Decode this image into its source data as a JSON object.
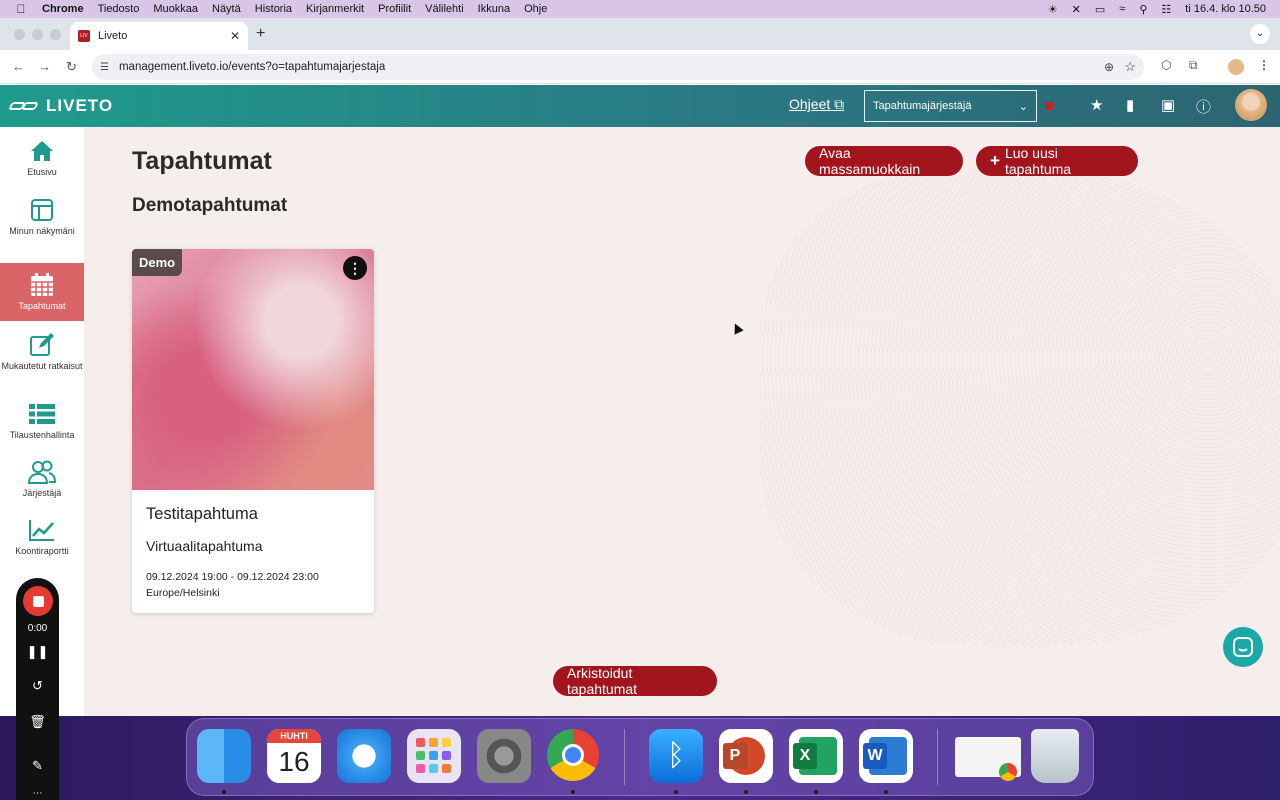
{
  "menubar": {
    "items": [
      "Chrome",
      "Tiedosto",
      "Muokkaa",
      "Näytä",
      "Historia",
      "Kirjanmerkit",
      "Profiilit",
      "Välilehti",
      "Ikkuna",
      "Ohje"
    ],
    "clock": "ti 16.4. klo 10.50"
  },
  "browser": {
    "tab_title": "Liveto",
    "url": "management.liveto.io/events?o=tapahtumajarjestaja"
  },
  "header": {
    "logo_text": "LIVETO",
    "help_link": "Ohjeet",
    "org_select": "Tapahtumajärjestäjä"
  },
  "sidebar": {
    "items": [
      {
        "label": "Etusivu",
        "icon": "home-icon"
      },
      {
        "label": "Minun näkymäni",
        "icon": "layout-icon"
      },
      {
        "label": "Tapahtumat",
        "icon": "calendar-icon",
        "active": true
      },
      {
        "label": "Mukautetut ratkaisut",
        "icon": "edit-icon"
      },
      {
        "label": "Tilaustenhallinta",
        "icon": "list-icon"
      },
      {
        "label": "Järjestäjä",
        "icon": "users-icon"
      },
      {
        "label": "Koontiraportti",
        "icon": "chart-icon"
      }
    ]
  },
  "main": {
    "title": "Tapahtumat",
    "bulk_edit_button": "Avaa massamuokkain",
    "create_button": "Luo uusi tapahtuma",
    "section_title": "Demotapahtumat",
    "archived_button": "Arkistoidut tapahtumat",
    "event_card": {
      "badge": "Demo",
      "name": "Testitapahtuma",
      "type": "Virtuaalitapahtuma",
      "dates": "09.12.2024 19:00 - 09.12.2024 23:00",
      "timezone": "Europe/Helsinki"
    }
  },
  "recorder": {
    "time": "0:00"
  },
  "dock": {
    "calendar_month": "HUHTI",
    "calendar_day": "16"
  },
  "colors": {
    "accent_red": "#a3151d",
    "header_teal": "#1f9b8c",
    "sidebar_active": "#d96567",
    "chat_teal": "#1aa9a5"
  }
}
